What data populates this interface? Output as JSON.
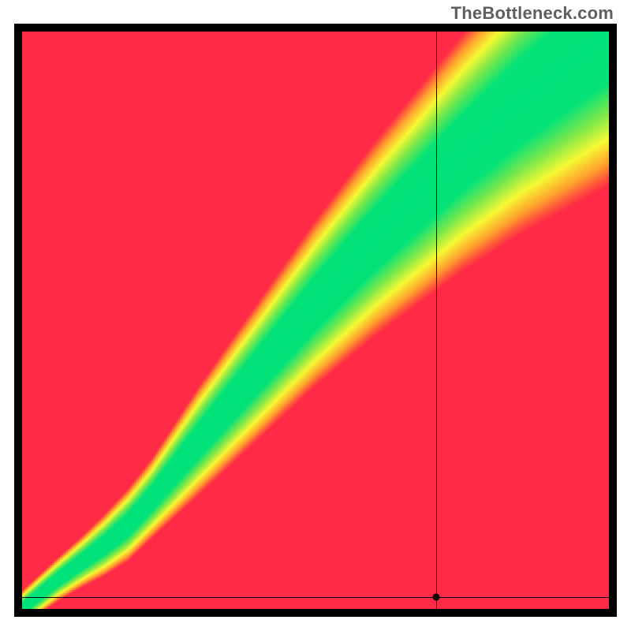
{
  "watermark": "TheBottleneck.com",
  "chart_data": {
    "type": "heatmap",
    "title": "",
    "xlabel": "",
    "ylabel": "",
    "xlim": [
      0,
      100
    ],
    "ylim": [
      0,
      100
    ],
    "legend": "none",
    "grid": false,
    "description": "Diagonal green band indicating balanced region; warm colors (red/orange) away from diagonal indicating bottleneck.",
    "ridge": [
      {
        "x": 0,
        "center": 0,
        "halfwidth": 1.0
      },
      {
        "x": 6,
        "center": 5.0,
        "halfwidth": 1.2
      },
      {
        "x": 10,
        "center": 8.0,
        "halfwidth": 1.4
      },
      {
        "x": 14,
        "center": 11.0,
        "halfwidth": 1.7
      },
      {
        "x": 18,
        "center": 14.5,
        "halfwidth": 2.0
      },
      {
        "x": 22,
        "center": 19.0,
        "halfwidth": 2.2
      },
      {
        "x": 26,
        "center": 24.0,
        "halfwidth": 2.6
      },
      {
        "x": 30,
        "center": 29.0,
        "halfwidth": 3.0
      },
      {
        "x": 35,
        "center": 35.0,
        "halfwidth": 3.4
      },
      {
        "x": 40,
        "center": 41.0,
        "halfwidth": 3.8
      },
      {
        "x": 45,
        "center": 47.0,
        "halfwidth": 4.2
      },
      {
        "x": 50,
        "center": 53.0,
        "halfwidth": 4.6
      },
      {
        "x": 55,
        "center": 58.5,
        "halfwidth": 5.0
      },
      {
        "x": 60,
        "center": 64.0,
        "halfwidth": 5.4
      },
      {
        "x": 65,
        "center": 69.0,
        "halfwidth": 5.8
      },
      {
        "x": 70,
        "center": 74.0,
        "halfwidth": 6.2
      },
      {
        "x": 75,
        "center": 79.0,
        "halfwidth": 6.6
      },
      {
        "x": 80,
        "center": 83.5,
        "halfwidth": 7.0
      },
      {
        "x": 85,
        "center": 88.0,
        "halfwidth": 7.4
      },
      {
        "x": 90,
        "center": 92.0,
        "halfwidth": 7.8
      },
      {
        "x": 95,
        "center": 96.0,
        "halfwidth": 8.2
      },
      {
        "x": 100,
        "center": 100.0,
        "halfwidth": 8.6
      }
    ],
    "color_stops": [
      {
        "t": 0.0,
        "hex": "#00e27a"
      },
      {
        "t": 0.3,
        "hex": "#7de84a"
      },
      {
        "t": 0.55,
        "hex": "#f6f933"
      },
      {
        "t": 0.78,
        "hex": "#ff9f2e"
      },
      {
        "t": 0.9,
        "hex": "#ff5a3a"
      },
      {
        "t": 1.0,
        "hex": "#ff2a45"
      }
    ],
    "crosshair": {
      "x": 70.5,
      "y": 2.0
    }
  }
}
